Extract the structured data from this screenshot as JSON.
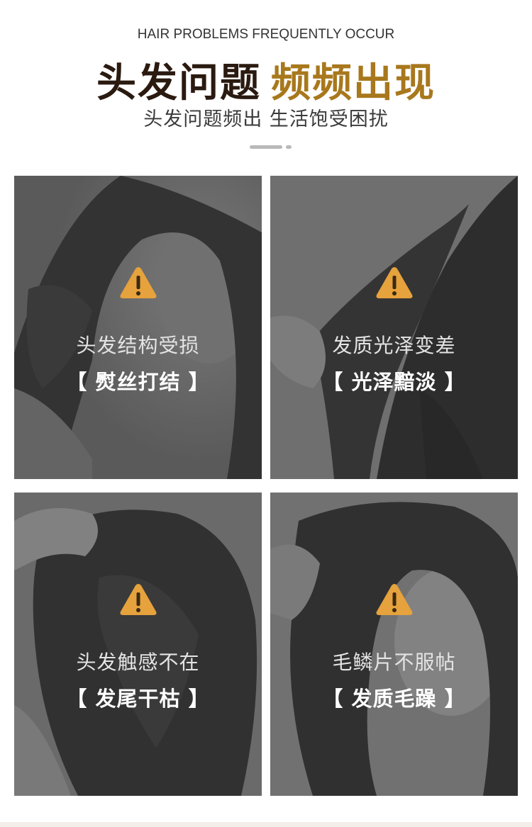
{
  "header": {
    "subtitle_en": "HAIR PROBLEMS FREQUENTLY OCCUR",
    "title_dark": "头发问题",
    "title_gold": "频频出现",
    "tagline": "头发问题频出 生活饱受困扰"
  },
  "colors": {
    "title_dark": "#2a1a10",
    "title_gold": "#a8781d",
    "warning_fill": "#e6a23c",
    "card_overlay": "#5a5a5a"
  },
  "cards": [
    {
      "line1": "头发结构受损",
      "line2": "【 熨丝打结 】",
      "icon": "warning-icon"
    },
    {
      "line1": "发质光泽变差",
      "line2": "【 光泽黯淡 】",
      "icon": "warning-icon"
    },
    {
      "line1": "头发触感不在",
      "line2": "【 发尾干枯 】",
      "icon": "warning-icon"
    },
    {
      "line1": "毛鳞片不服帖",
      "line2": "【 发质毛躁 】",
      "icon": "warning-icon"
    }
  ]
}
